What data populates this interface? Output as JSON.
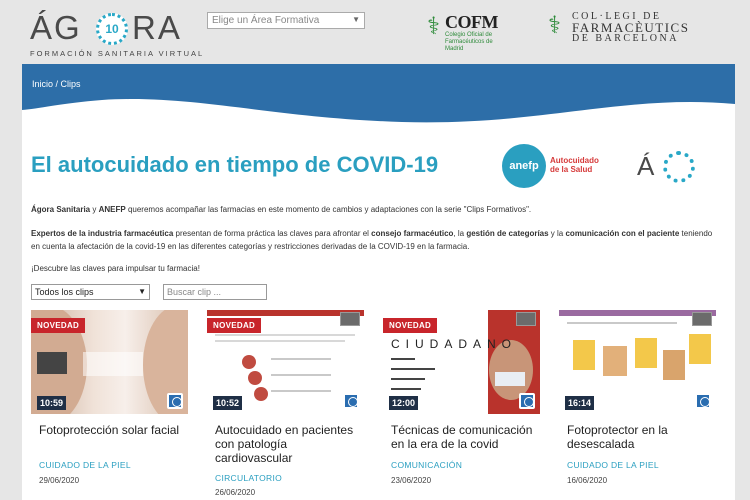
{
  "header": {
    "logo_letters_a": "ÁG",
    "logo_badge": "10",
    "logo_letters_b": "RA",
    "logo_subtitle": "FORMACIÓN SANITARIA VIRTUAL",
    "area_select_placeholder": "Elige un Área Formativa",
    "cofm_title": "COFM",
    "cofm_subtitle": "Colegio Oficial de Farmacéuticos de Madrid",
    "coll_line1": "COL·LEGI DE",
    "coll_line2": "FARMACÈUTICS",
    "coll_line3": "DE BARCELONA"
  },
  "breadcrumb": {
    "home": "Inicio",
    "separator": " / ",
    "current": "Clips"
  },
  "page": {
    "title": "El autocuidado en tiempo de COVID-19",
    "anefp_label": "anefp",
    "anefp_tag_line1": "Autocuidado",
    "anefp_tag_line2": "de la Salud"
  },
  "intro": {
    "p1_b1": "Ágora Sanitaria",
    "p1_t1": " y ",
    "p1_b2": "ANEFP",
    "p1_t2": " queremos acompañar las farmacias en este momento de cambios y adaptaciones con la serie \"Clips Formativos\".",
    "p2_b1": "Expertos de la industria farmacéutica",
    "p2_t1": " presentan de forma práctica las claves para afrontar el ",
    "p2_b2": "consejo farmacéutico",
    "p2_t2": ", la ",
    "p2_b3": "gestión de categorías",
    "p2_t3": " y la ",
    "p2_b4": "comunicación con el paciente",
    "p2_t4": " teniendo en cuenta la afectación de la covid-19 en las diferentes categorías y restricciones derivadas de la COVID-19 en la farmacia.",
    "p3": "¡Descubre las claves para impulsar tu farmacia!"
  },
  "filters": {
    "clip_select_value": "Todos los clips",
    "search_placeholder": "Buscar clip ..."
  },
  "cards": [
    {
      "badge": "NOVEDAD",
      "duration": "10:59",
      "title": "Fotoprotección solar facial",
      "category": "CUIDADO DE LA PIEL",
      "date": "29/06/2020"
    },
    {
      "badge": "NOVEDAD",
      "duration": "10:52",
      "title": "Autocuidado en pacientes con patología cardiovascular",
      "category": "CIRCULATORIO",
      "date": "26/06/2020"
    },
    {
      "badge": "NOVEDAD",
      "duration": "12:00",
      "title": "Técnicas de comunicación en la era de la covid",
      "category": "COMUNICACIÓN",
      "date": "23/06/2020"
    },
    {
      "badge": "",
      "duration": "16:14",
      "title": "Fotoprotector en la desescalada",
      "category": "CUIDADO DE LA PIEL",
      "date": "16/06/2020"
    }
  ],
  "colors": {
    "accent": "#2a9fc0",
    "band": "#2d6ea8",
    "badge": "#c8252b"
  }
}
